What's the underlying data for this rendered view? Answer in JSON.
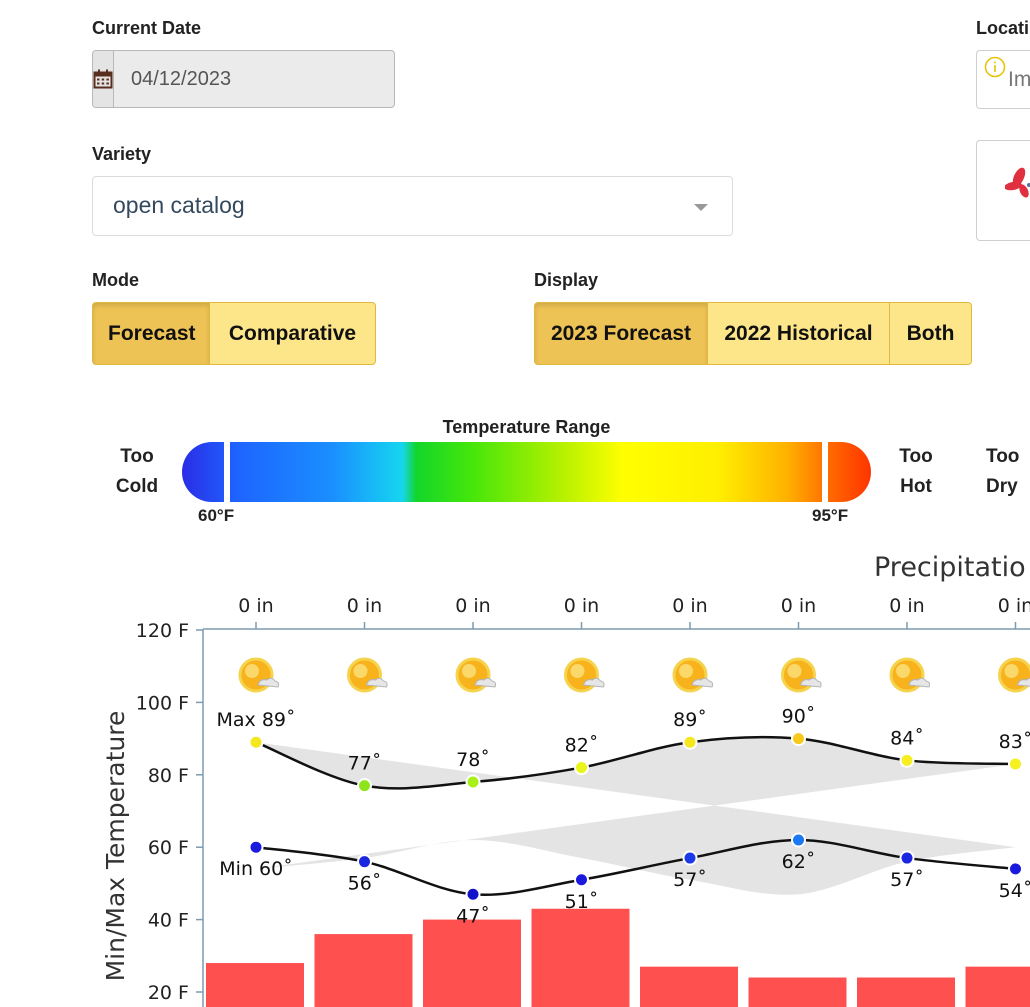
{
  "form": {
    "current_date_label": "Current Date",
    "current_date_value": "04/12/2023",
    "location_label": "Locati",
    "location_placeholder": "Im",
    "variety_label": "Variety",
    "variety_value": "open catalog",
    "mode_label": "Mode",
    "mode_options": [
      "Forecast",
      "Comparative"
    ],
    "mode_selected": "Forecast",
    "display_label": "Display",
    "display_options": [
      "2023 Forecast",
      "2022 Historical",
      "Both"
    ],
    "display_selected": "2023 Forecast"
  },
  "temperature_scale": {
    "title": "Temperature Range",
    "too_cold": [
      "Too",
      "Cold"
    ],
    "too_hot": [
      "Too",
      "Hot"
    ],
    "too_dry": [
      "Too",
      "Dry"
    ],
    "low_mark": "60°F",
    "high_mark": "95°F",
    "low_value": 60,
    "high_value": 95
  },
  "colors": {
    "accent": "#fde68a",
    "accent_active": "#eec355",
    "accent_border": "#e0b840",
    "precip_bar": "#ff5050",
    "band_fill": "#e4e4e4",
    "axis": "#7c9bb0",
    "info_icon": "#e6c200",
    "logo": "#e03040"
  },
  "icons": {
    "date": "calendar-icon",
    "location": "info-icon",
    "weather": "sun-cloud-icon",
    "dropdown": "chevron-down-icon"
  },
  "chart_data": {
    "type": "line",
    "title": "Precipitatio",
    "ylabel": "Min/Max Temperature",
    "ylim": [
      20,
      120
    ],
    "yticks": [
      20,
      40,
      60,
      80,
      100,
      120
    ],
    "ytick_labels": [
      "20 F",
      "40 F",
      "60 F",
      "80 F",
      "100 F",
      "120 F"
    ],
    "precip_labels": [
      "0 in",
      "0 in",
      "0 in",
      "0 in",
      "0 in",
      "0 in",
      "0 in",
      "0 in"
    ],
    "max_labels": [
      "Max 89˚",
      "77˚",
      "78˚",
      "82˚",
      "89˚",
      "90˚",
      "84˚",
      "83˚"
    ],
    "min_labels": [
      "Min 60˚",
      "56˚",
      "47˚",
      "51˚",
      "57˚",
      "62˚",
      "57˚",
      "54˚"
    ],
    "series": [
      {
        "name": "Max",
        "values": [
          89,
          77,
          78,
          82,
          89,
          90,
          84,
          83
        ]
      },
      {
        "name": "Min",
        "values": [
          60,
          56,
          47,
          51,
          57,
          62,
          57,
          54
        ]
      }
    ],
    "max_colors": [
      "#f6e61e",
      "#8ee41a",
      "#a8f01a",
      "#e8f41a",
      "#f6e61e",
      "#f7c91a",
      "#f6ee1e",
      "#f6f01e"
    ],
    "min_colors": [
      "#1a1adf",
      "#1a26df",
      "#1212c8",
      "#1a1adf",
      "#1a3ae8",
      "#1a78f0",
      "#1a26df",
      "#1a1adf"
    ],
    "bars": {
      "values": [
        28,
        36,
        40,
        43,
        27,
        24,
        24,
        27
      ]
    }
  }
}
